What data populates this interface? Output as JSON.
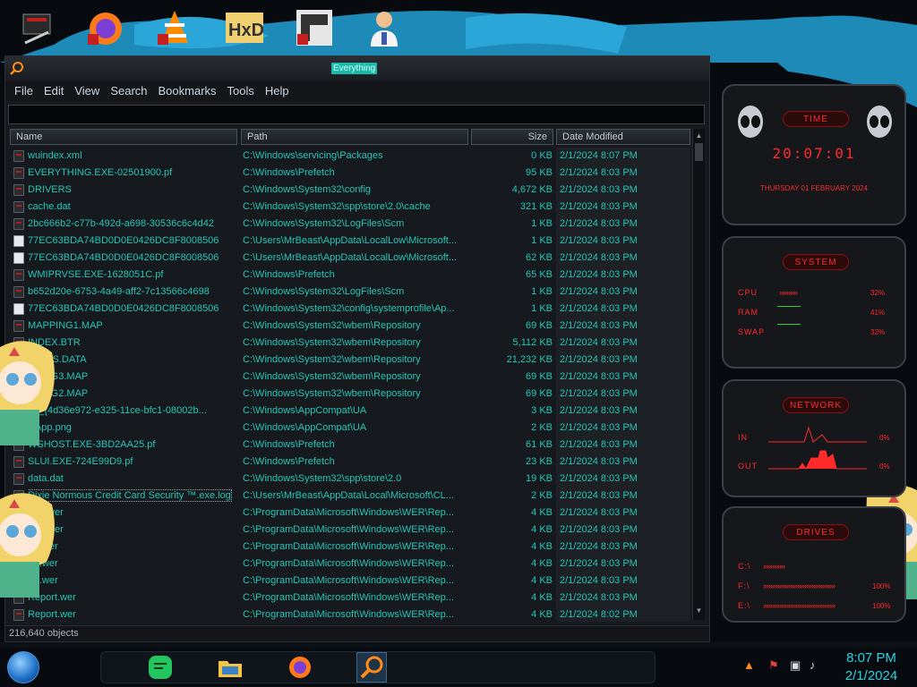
{
  "window": {
    "title": "Everything"
  },
  "menu": [
    "File",
    "Edit",
    "View",
    "Search",
    "Bookmarks",
    "Tools",
    "Help"
  ],
  "search": {
    "value": ""
  },
  "columns": {
    "name": "Name",
    "path": "Path",
    "size": "Size",
    "date": "Date Modified"
  },
  "rows": [
    {
      "name": "wuindex.xml",
      "path": "C:\\Windows\\servicing\\Packages",
      "size": "0 KB",
      "date": "2/1/2024 8:07 PM",
      "icon": "dark"
    },
    {
      "name": "EVERYTHING.EXE-02501900.pf",
      "path": "C:\\Windows\\Prefetch",
      "size": "95 KB",
      "date": "2/1/2024 8:03 PM",
      "icon": "dark"
    },
    {
      "name": "DRIVERS",
      "path": "C:\\Windows\\System32\\config",
      "size": "4,672 KB",
      "date": "2/1/2024 8:03 PM",
      "icon": "dark"
    },
    {
      "name": "cache.dat",
      "path": "C:\\Windows\\System32\\spp\\store\\2.0\\cache",
      "size": "321 KB",
      "date": "2/1/2024 8:03 PM",
      "icon": "dark"
    },
    {
      "name": "2bc666b2-c77b-492d-a698-30536c6c4d42",
      "path": "C:\\Windows\\System32\\LogFiles\\Scm",
      "size": "1 KB",
      "date": "2/1/2024 8:03 PM",
      "icon": "dark"
    },
    {
      "name": "77EC63BDA74BD0D0E0426DC8F8008506",
      "path": "C:\\Users\\MrBeast\\AppData\\LocalLow\\Microsoft...",
      "size": "1 KB",
      "date": "2/1/2024 8:03 PM",
      "icon": "light"
    },
    {
      "name": "77EC63BDA74BD0D0E0426DC8F8008506",
      "path": "C:\\Users\\MrBeast\\AppData\\LocalLow\\Microsoft...",
      "size": "62 KB",
      "date": "2/1/2024 8:03 PM",
      "icon": "light"
    },
    {
      "name": "WMIPRVSE.EXE-1628051C.pf",
      "path": "C:\\Windows\\Prefetch",
      "size": "65 KB",
      "date": "2/1/2024 8:03 PM",
      "icon": "dark"
    },
    {
      "name": "b652d20e-6753-4a49-aff2-7c13566c4698",
      "path": "C:\\Windows\\System32\\LogFiles\\Scm",
      "size": "1 KB",
      "date": "2/1/2024 8:03 PM",
      "icon": "dark"
    },
    {
      "name": "77EC63BDA74BD0D0E0426DC8F8008506",
      "path": "C:\\Windows\\System32\\config\\systemprofile\\Ap...",
      "size": "1 KB",
      "date": "2/1/2024 8:03 PM",
      "icon": "light"
    },
    {
      "name": "MAPPING1.MAP",
      "path": "C:\\Windows\\System32\\wbem\\Repository",
      "size": "69 KB",
      "date": "2/1/2024 8:03 PM",
      "icon": "dark"
    },
    {
      "name": "INDEX.BTR",
      "path": "C:\\Windows\\System32\\wbem\\Repository",
      "size": "5,112 KB",
      "date": "2/1/2024 8:03 PM",
      "icon": "dark"
    },
    {
      "name": "JECTS.DATA",
      "path": "C:\\Windows\\System32\\wbem\\Repository",
      "size": "21,232 KB",
      "date": "2/1/2024 8:03 PM",
      "icon": "dark"
    },
    {
      "name": "PPING3.MAP",
      "path": "C:\\Windows\\System32\\wbem\\Repository",
      "size": "69 KB",
      "date": "2/1/2024 8:03 PM",
      "icon": "dark"
    },
    {
      "name": "PPING2.MAP",
      "path": "C:\\Windows\\System32\\wbem\\Repository",
      "size": "69 KB",
      "date": "2/1/2024 8:03 PM",
      "icon": "dark"
    },
    {
      "name": "on_{4d36e972-e325-11ce-bfc1-08002b...",
      "path": "C:\\Windows\\AppCompat\\UA",
      "size": "3 KB",
      "date": "2/1/2024 8:03 PM",
      "icon": "dark"
    },
    {
      "name": "icApp.png",
      "path": "C:\\Windows\\AppCompat\\UA",
      "size": "2 KB",
      "date": "2/1/2024 8:03 PM",
      "icon": "dark"
    },
    {
      "name": "WSHOST.EXE-3BD2AA25.pf",
      "path": "C:\\Windows\\Prefetch",
      "size": "61 KB",
      "date": "2/1/2024 8:03 PM",
      "icon": "dark"
    },
    {
      "name": "SLUI.EXE-724E99D9.pf",
      "path": "C:\\Windows\\Prefetch",
      "size": "23 KB",
      "date": "2/1/2024 8:03 PM",
      "icon": "dark"
    },
    {
      "name": "data.dat",
      "path": "C:\\Windows\\System32\\spp\\store\\2.0",
      "size": "19 KB",
      "date": "2/1/2024 8:03 PM",
      "icon": "dark"
    },
    {
      "name": "Dixie Normous Credit Card Security ™.exe.log",
      "path": "C:\\Users\\MrBeast\\AppData\\Local\\Microsoft\\CL...",
      "size": "2 KB",
      "date": "2/1/2024 8:03 PM",
      "icon": "dark",
      "selected": true
    },
    {
      "name": "port.wer",
      "path": "C:\\ProgramData\\Microsoft\\Windows\\WER\\Rep...",
      "size": "4 KB",
      "date": "2/1/2024 8:03 PM",
      "icon": "dark"
    },
    {
      "name": "port.wer",
      "path": "C:\\ProgramData\\Microsoft\\Windows\\WER\\Rep...",
      "size": "4 KB",
      "date": "2/1/2024 8:03 PM",
      "icon": "dark"
    },
    {
      "name": "ort.wer",
      "path": "C:\\ProgramData\\Microsoft\\Windows\\WER\\Rep...",
      "size": "4 KB",
      "date": "2/1/2024 8:03 PM",
      "icon": "dark"
    },
    {
      "name": "ort.wer",
      "path": "C:\\ProgramData\\Microsoft\\Windows\\WER\\Rep...",
      "size": "4 KB",
      "date": "2/1/2024 8:03 PM",
      "icon": "dark"
    },
    {
      "name": "ort.wer",
      "path": "C:\\ProgramData\\Microsoft\\Windows\\WER\\Rep...",
      "size": "4 KB",
      "date": "2/1/2024 8:03 PM",
      "icon": "dark"
    },
    {
      "name": "Report.wer",
      "path": "C:\\ProgramData\\Microsoft\\Windows\\WER\\Rep...",
      "size": "4 KB",
      "date": "2/1/2024 8:03 PM",
      "icon": "dark"
    },
    {
      "name": "Report.wer",
      "path": "C:\\ProgramData\\Microsoft\\Windows\\WER\\Rep...",
      "size": "4 KB",
      "date": "2/1/2024 8:02 PM",
      "icon": "dark"
    }
  ],
  "status": "216,640 objects",
  "widgets": {
    "time": {
      "title": "TIME",
      "clock": "20:07:01",
      "date": "THURSDAY 01 FEBRUARY 2024"
    },
    "system": {
      "title": "SYSTEM",
      "cpu_label": "CPU",
      "ram_label": "RAM",
      "swap_label": "SWAP",
      "cpu": "32%",
      "ram": "41%",
      "swap": "32%"
    },
    "network": {
      "title": "NETWORK",
      "in_label": "IN",
      "out_label": "OUT",
      "in": "0%",
      "out": "0%"
    },
    "drives": {
      "title": "DRIVES",
      "d1": "C:\\",
      "d2": "F:\\",
      "d3": "E:\\",
      "d2_val": "100%",
      "d3_val": "100%"
    }
  },
  "taskbar": {
    "time": "8:07 PM",
    "date": "2/1/2024"
  },
  "colors": {
    "accent": "#25c7b6",
    "widget_red": "#ff2a2a",
    "clock": "#29d3e0"
  }
}
